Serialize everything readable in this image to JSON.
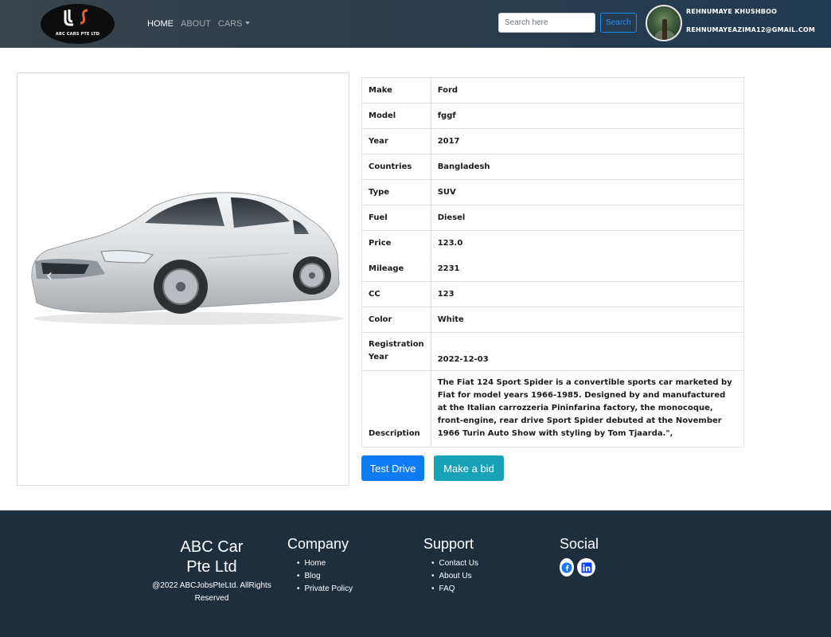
{
  "brand": {
    "logo_text": "ABC CARS PTE LTD"
  },
  "nav": {
    "home": "HOME",
    "about": "ABOUT",
    "cars": "CARS"
  },
  "search": {
    "placeholder": "Search here",
    "button": "Search"
  },
  "user": {
    "name": "REHNUMAYE KHUSHBOO",
    "email": "REHNUMAYEAZIMA12@GMAIL.COM"
  },
  "car": {
    "specs": [
      {
        "label": "Make",
        "value": "Ford"
      },
      {
        "label": "Model",
        "value": "fggf"
      },
      {
        "label": "Year",
        "value": "2017"
      },
      {
        "label": "Countries",
        "value": "Bangladesh"
      },
      {
        "label": "Type",
        "value": "SUV"
      },
      {
        "label": "Fuel",
        "value": "Diesel"
      },
      {
        "label": "Price",
        "value": "123.0"
      },
      {
        "label": "Mileage",
        "value": "2231"
      },
      {
        "label": "CC",
        "value": "123"
      },
      {
        "label": "Color",
        "value": "White"
      },
      {
        "label": "Registration Year",
        "value": "2022-12-03"
      },
      {
        "label": "Description",
        "value": "The Fiat 124 Sport Spider is a convertible sports car marketed by Fiat for model years 1966-1985. Designed by and manufactured at the Italian carrozzeria Pininfarina factory, the monocoque, front-engine, rear drive Sport Spider debuted at the November 1966 Turin Auto Show with styling by Tom Tjaarda.\","
      }
    ]
  },
  "actions": {
    "test_drive": "Test Drive",
    "bid": "Make a bid"
  },
  "footer": {
    "brand": "ABC Car Pte Ltd",
    "copyright": "@2022 ABCJobsPteLtd. AllRights Reserved",
    "company": {
      "title": "Company",
      "links": [
        "Home",
        "Blog",
        "Private Policy"
      ]
    },
    "support": {
      "title": "Support",
      "links": [
        "Contact Us",
        "About Us",
        "FAQ"
      ]
    },
    "social": {
      "title": "Social",
      "icons": [
        "facebook-icon",
        "linkedin-icon"
      ]
    }
  },
  "colors": {
    "primary": "#0d7cf2",
    "info": "#17a2b8",
    "footer_bg": "#1f2e3d",
    "nav_bg": "#2f3d4a"
  }
}
